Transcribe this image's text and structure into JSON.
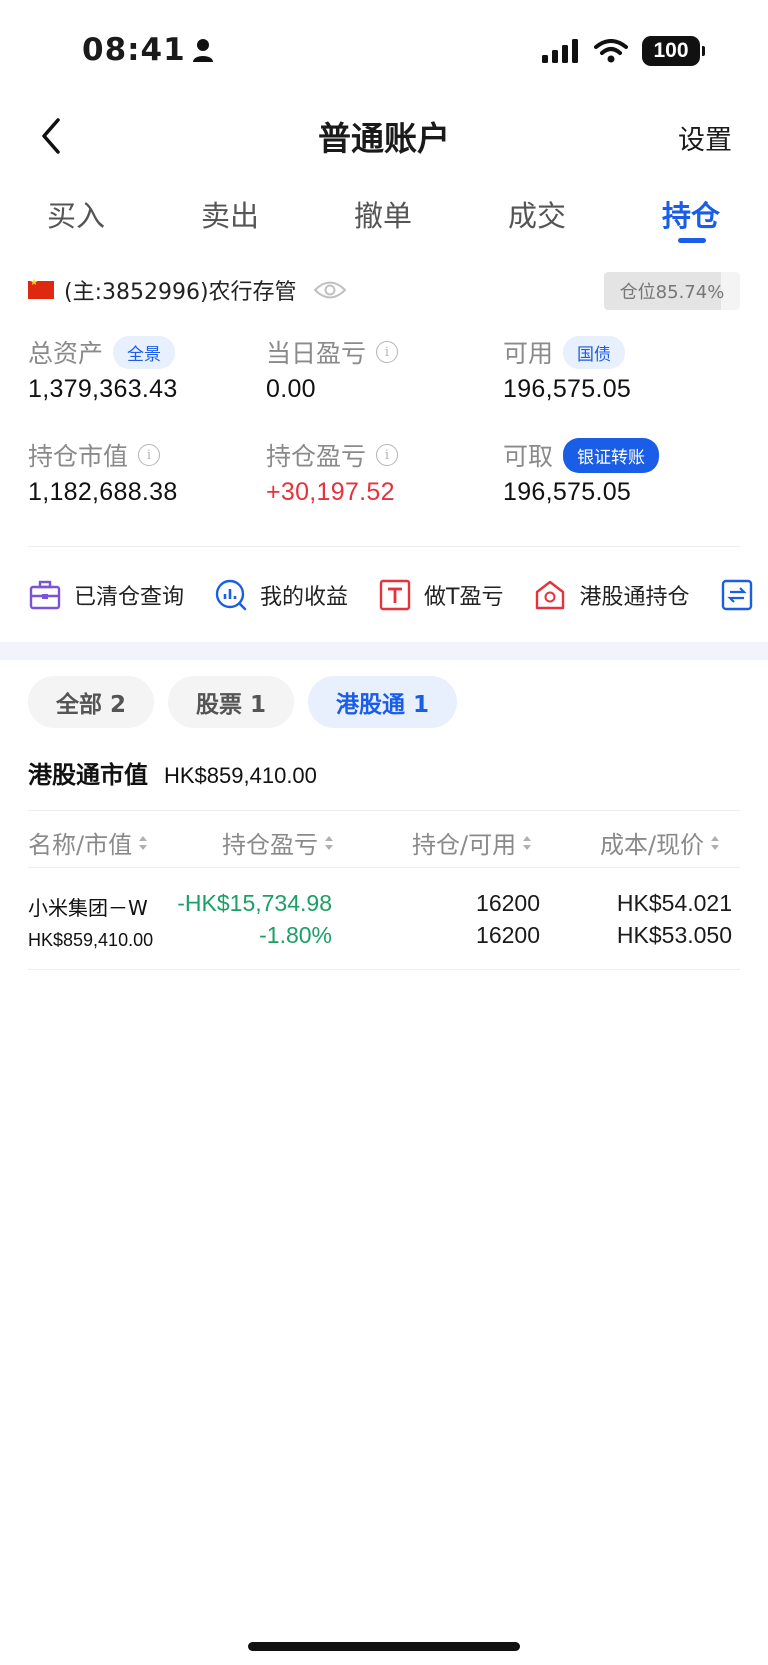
{
  "status_bar": {
    "time": "08:41",
    "battery": "100"
  },
  "nav": {
    "title": "普通账户",
    "settings_label": "设置"
  },
  "tabs": [
    {
      "label": "买入"
    },
    {
      "label": "卖出"
    },
    {
      "label": "撤单"
    },
    {
      "label": "成交"
    },
    {
      "label": "持仓",
      "active": true
    }
  ],
  "account": {
    "text": "(主:3852996)农行存管",
    "position_ratio": "仓位85.74%",
    "position_fraction": 0.8574
  },
  "metrics": {
    "total_assets": {
      "label": "总资产",
      "badge": "全景",
      "value": "1,379,363.43"
    },
    "daily_pnl": {
      "label": "当日盈亏",
      "value": "0.00"
    },
    "available": {
      "label": "可用",
      "badge": "国债",
      "value": "196,575.05"
    },
    "holding_value": {
      "label": "持仓市值",
      "value": "1,182,688.38"
    },
    "holding_pnl": {
      "label": "持仓盈亏",
      "value": "+30,197.52"
    },
    "withdrawable": {
      "label": "可取",
      "badge": "银证转账",
      "value": "196,575.05"
    }
  },
  "shortcuts": [
    {
      "label": "已清仓查询",
      "icon": "briefcase-icon"
    },
    {
      "label": "我的收益",
      "icon": "chart-search-icon"
    },
    {
      "label": "做T盈亏",
      "icon": "t-box-icon"
    },
    {
      "label": "港股通持仓",
      "icon": "hk-house-icon"
    }
  ],
  "filters": [
    {
      "label": "全部 2"
    },
    {
      "label": "股票 1"
    },
    {
      "label": "港股通 1",
      "active": true
    }
  ],
  "market_value": {
    "label": "港股通市值",
    "value": "HK$859,410.00"
  },
  "table": {
    "headers": [
      "名称/市值",
      "持仓盈亏",
      "持仓/可用",
      "成本/现价"
    ],
    "rows": [
      {
        "name": "小米集团－W",
        "market_value": "HK$859,410.00",
        "pnl": "-HK$15,734.98",
        "pnl_pct": "-1.80%",
        "holding": "16200",
        "available": "16200",
        "cost": "HK$54.021",
        "price": "HK$53.050"
      }
    ]
  },
  "colors": {
    "accent": "#1a5ee8",
    "loss": "#1aa067",
    "gain": "#e5323c"
  }
}
